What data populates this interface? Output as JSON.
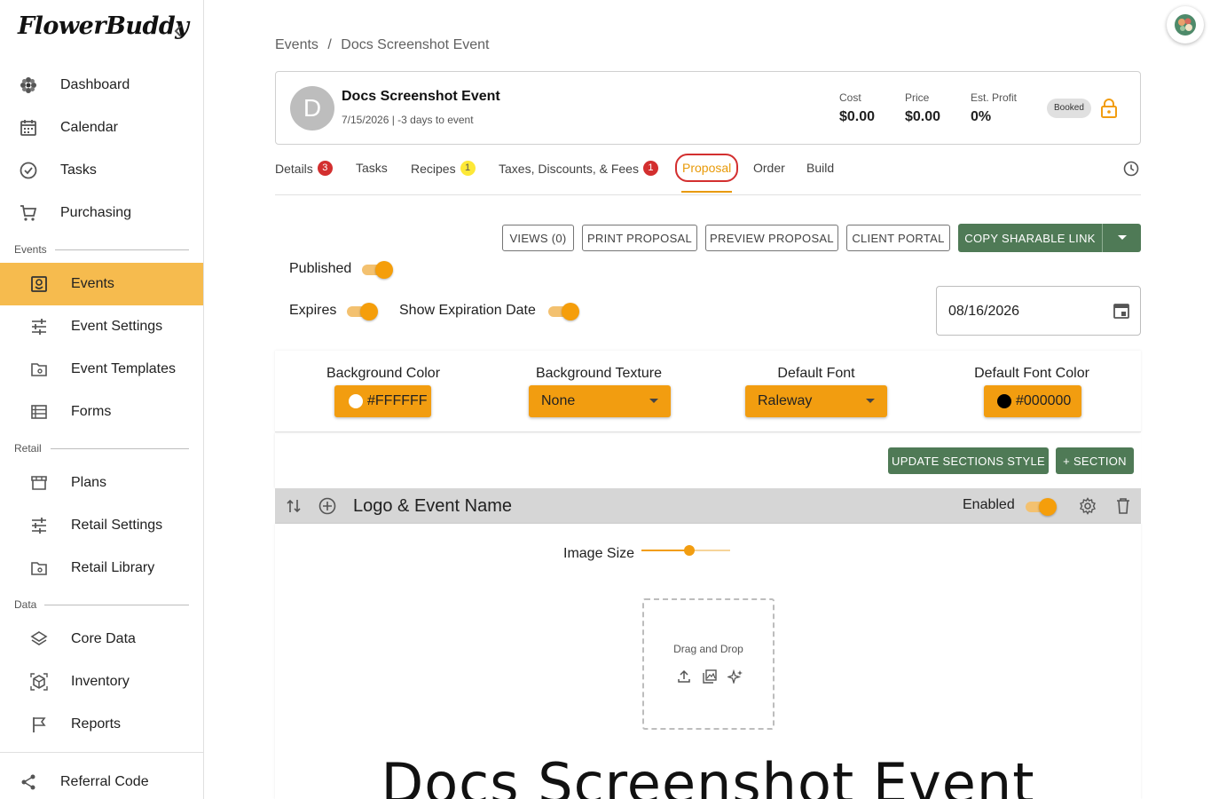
{
  "app": {
    "logo": "FlowerBuddy"
  },
  "sidebar": {
    "top_items": [
      {
        "label": "Dashboard",
        "icon": "flower-icon"
      },
      {
        "label": "Calendar",
        "icon": "calendar-icon"
      },
      {
        "label": "Tasks",
        "icon": "check-circle-icon"
      },
      {
        "label": "Purchasing",
        "icon": "cart-icon"
      }
    ],
    "groups": [
      {
        "label": "Events",
        "items": [
          {
            "label": "Events",
            "icon": "event-flower-icon",
            "active": true
          },
          {
            "label": "Event Settings",
            "icon": "sliders-icon"
          },
          {
            "label": "Event Templates",
            "icon": "folder-icon"
          },
          {
            "label": "Forms",
            "icon": "list-icon"
          }
        ]
      },
      {
        "label": "Retail",
        "items": [
          {
            "label": "Plans",
            "icon": "store-icon"
          },
          {
            "label": "Retail Settings",
            "icon": "sliders-icon"
          },
          {
            "label": "Retail Library",
            "icon": "folder-icon"
          }
        ]
      },
      {
        "label": "Data",
        "items": [
          {
            "label": "Core Data",
            "icon": "layers-icon"
          },
          {
            "label": "Inventory",
            "icon": "cube-icon"
          },
          {
            "label": "Reports",
            "icon": "flag-icon"
          }
        ]
      }
    ],
    "footer_item": {
      "label": "Referral Code",
      "icon": "share-icon"
    }
  },
  "breadcrumb": {
    "root": "Events",
    "separator": "/",
    "current": "Docs Screenshot Event"
  },
  "event": {
    "avatar_letter": "D",
    "title": "Docs Screenshot Event",
    "subtitle": "7/15/2026 | -3 days to event",
    "stats": [
      {
        "label": "Cost",
        "value": "$0.00"
      },
      {
        "label": "Price",
        "value": "$0.00"
      },
      {
        "label": "Est. Profit",
        "value": "0%"
      }
    ],
    "status": "Booked"
  },
  "tabs": [
    {
      "label": "Details",
      "count": "3",
      "count_color": "red"
    },
    {
      "label": "Tasks"
    },
    {
      "label": "Recipes",
      "count": "1",
      "count_color": "yellow"
    },
    {
      "label": "Taxes, Discounts, & Fees",
      "count": "1",
      "count_color": "red"
    },
    {
      "label": "Proposal",
      "active": true
    },
    {
      "label": "Order"
    },
    {
      "label": "Build"
    }
  ],
  "actions": {
    "views": "VIEWS (0)",
    "print": "PRINT PROPOSAL",
    "preview": "PREVIEW PROPOSAL",
    "client_portal": "CLIENT PORTAL",
    "copy_link": "COPY SHARABLE LINK"
  },
  "toggles": {
    "published": "Published",
    "expires": "Expires",
    "show_expiration": "Show Expiration Date"
  },
  "expiration_date": "08/16/2026",
  "style": {
    "background_color_label": "Background Color",
    "background_color_value": "#FFFFFF",
    "background_texture_label": "Background Texture",
    "background_texture_value": "None",
    "default_font_label": "Default Font",
    "default_font_value": "Raleway",
    "default_font_color_label": "Default Font Color",
    "default_font_color_value": "#000000"
  },
  "section_buttons": {
    "update": "UPDATE SECTIONS STYLE",
    "add": "+ SECTION"
  },
  "section": {
    "title": "Logo & Event Name",
    "enabled_label": "Enabled",
    "image_size_label": "Image Size",
    "image_size_level": 0.54,
    "drop_text": "Drag and Drop",
    "event_name": "Docs Screenshot Event"
  },
  "colors": {
    "accent": "#F29D10",
    "active_nav": "#F6BB4E",
    "green": "#4F7A56",
    "badge_red": "#D32F2F"
  }
}
